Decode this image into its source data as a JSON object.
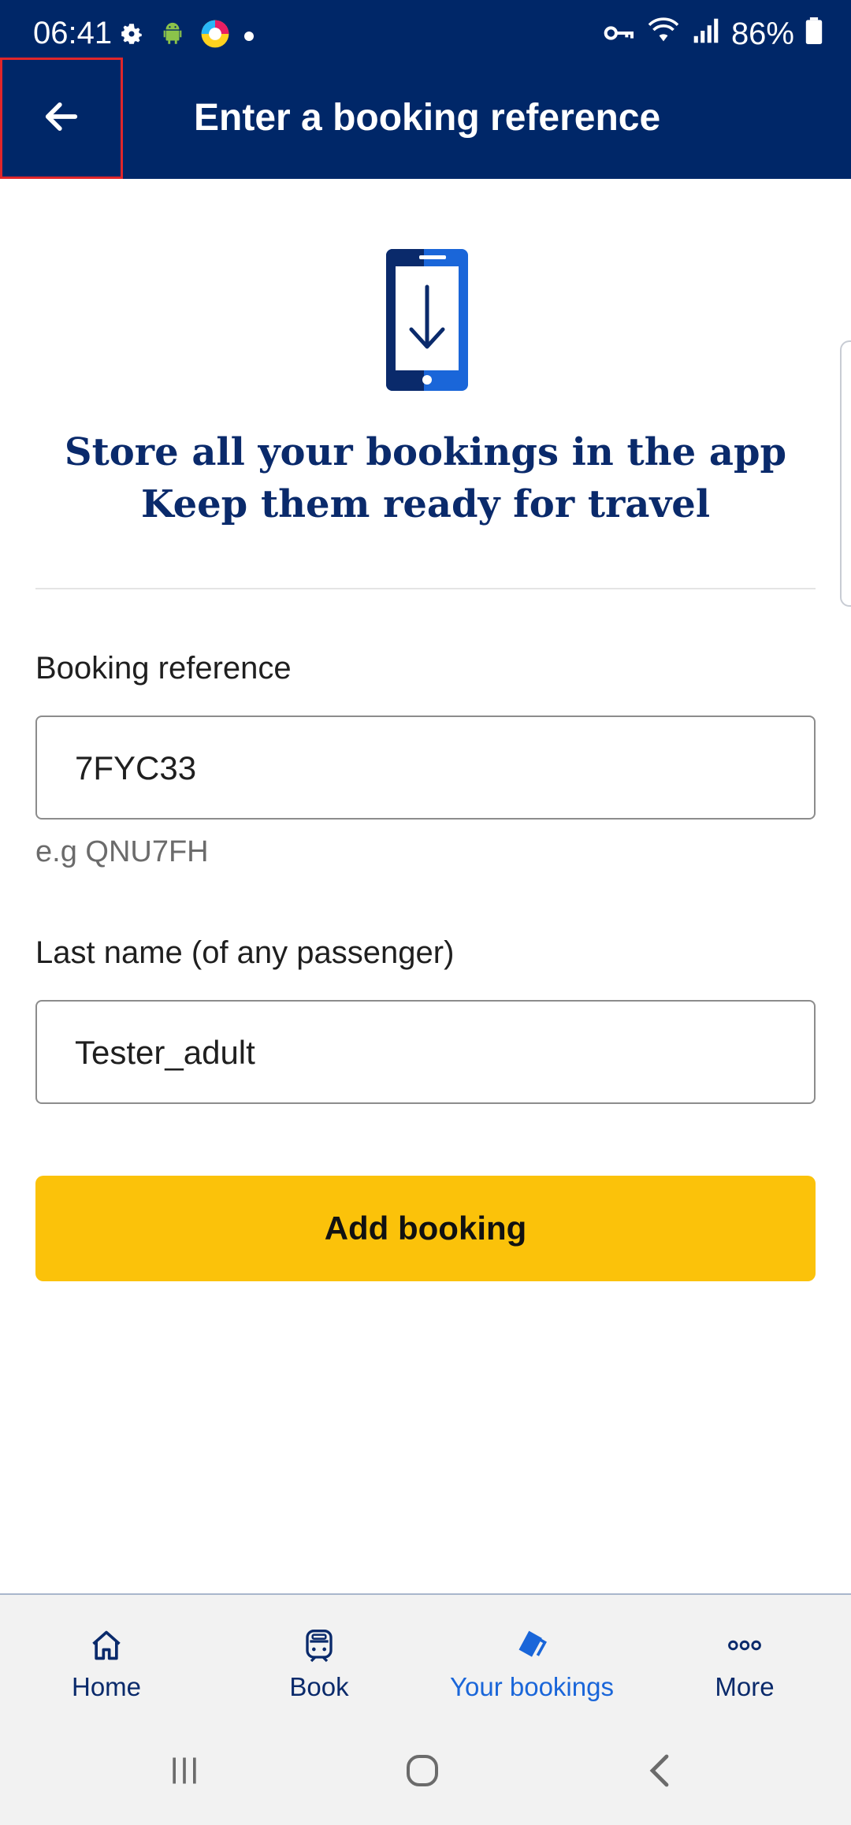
{
  "status_bar": {
    "time": "06:41",
    "battery": "86%",
    "icons": [
      "settings-icon",
      "android-icon",
      "app-icon",
      "vpn-key-icon",
      "wifi-icon",
      "signal-icon",
      "battery-icon"
    ]
  },
  "app_bar": {
    "title": "Enter a booking reference",
    "back_icon": "arrow-left-icon"
  },
  "hero": {
    "icon": "phone-download-icon",
    "line1": "Store all your bookings in the app",
    "line2": "Keep them ready for travel"
  },
  "form": {
    "booking_reference": {
      "label": "Booking reference",
      "value": "7FYC33",
      "hint": "e.g QNU7FH"
    },
    "last_name": {
      "label": "Last name (of any passenger)",
      "value": "Tester_adult"
    },
    "submit_label": "Add booking"
  },
  "bottom_nav": {
    "items": [
      {
        "label": "Home",
        "icon": "home-icon"
      },
      {
        "label": "Book",
        "icon": "train-icon"
      },
      {
        "label": "Your bookings",
        "icon": "tickets-icon",
        "active": true
      },
      {
        "label": "More",
        "icon": "more-icon"
      }
    ]
  },
  "colors": {
    "header_bg": "#002768",
    "accent": "#fbc20a",
    "active_nav": "#1a66d9",
    "hero_text": "#0a2a6b"
  }
}
